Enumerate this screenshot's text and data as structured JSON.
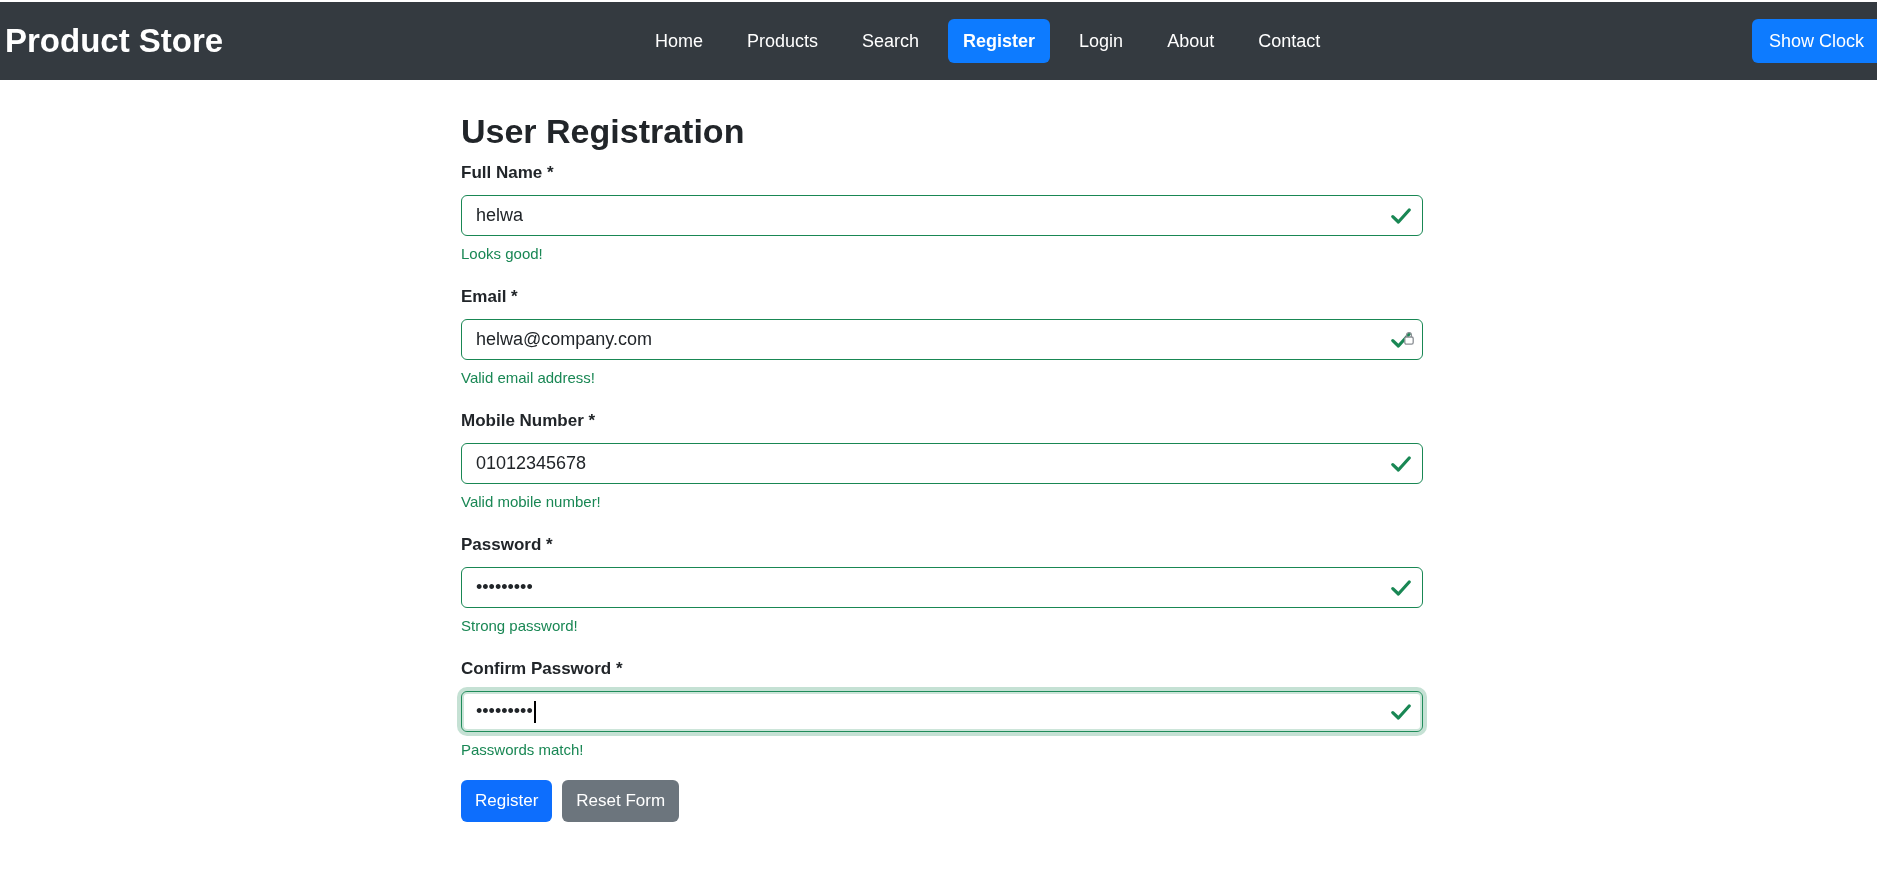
{
  "navbar": {
    "brand": "Product Store",
    "links": [
      {
        "label": "Home",
        "selected": false
      },
      {
        "label": "Products",
        "selected": false
      },
      {
        "label": "Search",
        "selected": false
      },
      {
        "label": "Register",
        "selected": true
      },
      {
        "label": "Login",
        "selected": false
      },
      {
        "label": "About",
        "selected": false
      },
      {
        "label": "Contact",
        "selected": false
      }
    ],
    "button": "Show Clock"
  },
  "form": {
    "title": "User Registration",
    "fields": [
      {
        "label": "Full Name *",
        "value": "helwa",
        "valid": true,
        "feedback": "Looks good!",
        "focused": false,
        "autofill_icon": false
      },
      {
        "label": "Email *",
        "value": "helwa@company.com",
        "valid": true,
        "feedback": "Valid email address!",
        "focused": false,
        "autofill_icon": true
      },
      {
        "label": "Mobile Number *",
        "value": "01012345678",
        "valid": true,
        "feedback": "Valid mobile number!",
        "focused": false,
        "autofill_icon": false
      },
      {
        "label": "Password *",
        "value": "•••••••••",
        "valid": true,
        "feedback": "Strong password!",
        "focused": false,
        "autofill_icon": false
      },
      {
        "label": "Confirm Password *",
        "value": "•••••••••",
        "valid": true,
        "feedback": "Passwords match!",
        "focused": true,
        "autofill_icon": false
      }
    ],
    "buttons": [
      {
        "label": "Register",
        "kind": "primary"
      },
      {
        "label": "Reset Form",
        "kind": "secondary"
      }
    ]
  }
}
